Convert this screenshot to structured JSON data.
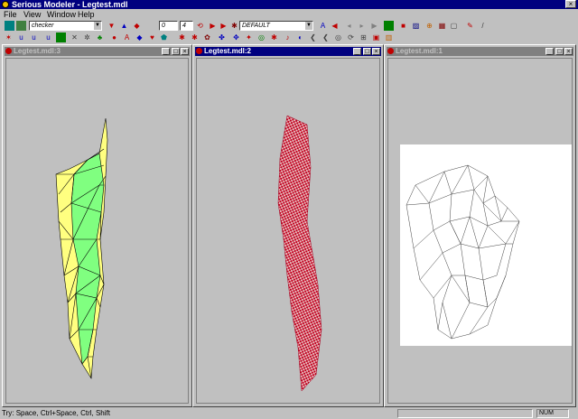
{
  "window": {
    "title": "Serious Modeler - Legtest.mdl",
    "close": "×"
  },
  "menu": {
    "file": "File",
    "view": "View",
    "window": "Window",
    "help": "Help"
  },
  "toolbar1": {
    "texture_select": "checker",
    "frame_start": "0",
    "frame_end": "4",
    "animation_select": "DEFAULT"
  },
  "windows": [
    {
      "title": "Legtest.mdl:3",
      "active": false
    },
    {
      "title": "Legtest.mdl:2",
      "active": true
    },
    {
      "title": "Legtest.mdl:1",
      "active": false
    }
  ],
  "window_buttons": {
    "minimize": "_",
    "maximize": "□",
    "close": "×"
  },
  "status": {
    "message": "Try: Space, Ctrl+Space, Ctrl, Shift",
    "num": "NUM"
  },
  "colors": {
    "title_active": "#00007f",
    "title_inactive": "#808080",
    "viewport_bg": "#c0c0c0",
    "model_yellow": "#ffff80",
    "model_green": "#80ff80",
    "checker_red": "#c00020",
    "mapping_bg": "#ffffff"
  },
  "icons": [
    "open-icon",
    "save-icon",
    "texture-icon",
    "lights-icon",
    "play-icon",
    "stop-icon",
    "frame-first-icon",
    "frame-last-icon",
    "settings-icon",
    "zoom-icon",
    "camera-icon"
  ]
}
